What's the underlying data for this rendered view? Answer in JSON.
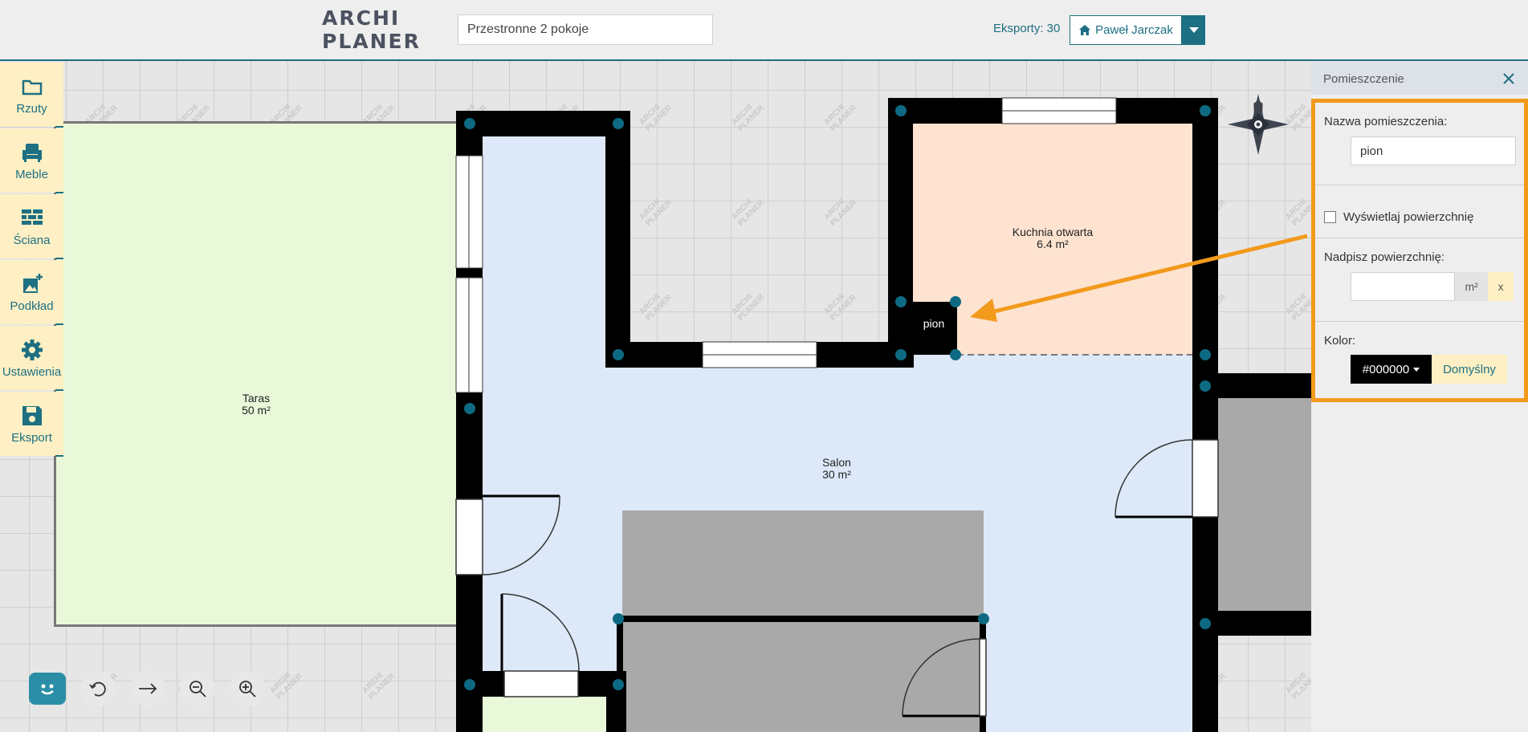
{
  "app": {
    "logo_line1": "ARCHI",
    "logo_line2": "PLANER"
  },
  "header": {
    "plan_name": "Przestronne 2 pokoje",
    "exports_label": "Eksporty: 30",
    "user_name": "Paweł Jarczak"
  },
  "sidebar": {
    "items": [
      {
        "label": "Rzuty",
        "icon": "folder-icon"
      },
      {
        "label": "Meble",
        "icon": "armchair-icon"
      },
      {
        "label": "Ściana",
        "icon": "brick-wall-icon"
      },
      {
        "label": "Podkład",
        "icon": "image-add-icon"
      },
      {
        "label": "Ustawienia",
        "icon": "gear-icon"
      },
      {
        "label": "Eksport",
        "icon": "floppy-disk-icon"
      }
    ]
  },
  "plan": {
    "rooms": [
      {
        "name": "Taras",
        "area": "50 m²",
        "color": "#e9f8d9"
      },
      {
        "name": "Salon",
        "area": "30 m²",
        "color": "#dde9f9"
      },
      {
        "name": "Kuchnia otwarta",
        "area": "6.4 m²",
        "color": "#fde3d0"
      },
      {
        "name": "pion",
        "area": "",
        "color": "#000000"
      }
    ],
    "compass_label": "N",
    "watermark_line1": "ARCHI",
    "watermark_line2": "PLANER"
  },
  "bottom_toolbar": {
    "tools": [
      "chat-bot-icon",
      "undo-icon",
      "redo-arrow-icon",
      "zoom-out-icon",
      "zoom-in-icon"
    ]
  },
  "panel": {
    "title": "Pomieszczenie",
    "name_label": "Nazwa pomieszczenia:",
    "name_value": "pion",
    "show_area_label": "Wyświetlaj powierzchnię",
    "show_area_checked": false,
    "override_area_label": "Nadpisz powierzchnię:",
    "override_area_value": "",
    "area_unit": "m²",
    "clear_label": "x",
    "color_label": "Kolor:",
    "color_value": "#000000",
    "default_label": "Domyślny"
  },
  "colors": {
    "accent": "#1d6f82",
    "highlight": "#f29a1c",
    "sidebar_bg": "#fef0c4",
    "wall": "#000000",
    "node": "#0e6a82"
  }
}
